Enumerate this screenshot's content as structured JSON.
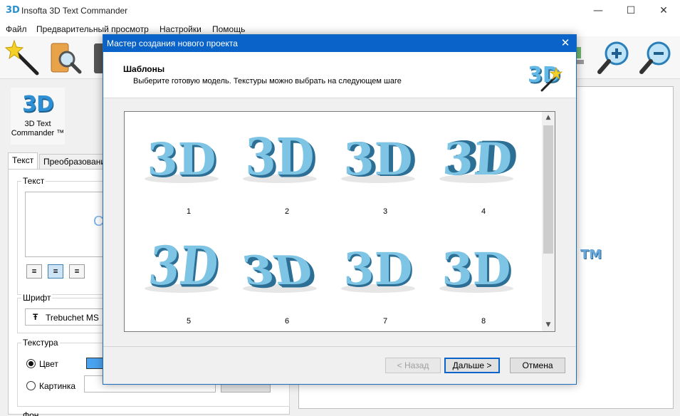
{
  "window": {
    "logo_text": "3D",
    "title": "Insofta 3D Text Commander",
    "minimize": "—",
    "maximize": "☐",
    "close": "✕"
  },
  "menu": [
    "Файл",
    "Предварительный просмотр",
    "Настройки",
    "Помощь"
  ],
  "toolbar": {
    "icons": [
      "magic-wand-icon",
      "open-folder-icon",
      "save-icon",
      "zoom-in-icon",
      "zoom-out-icon"
    ]
  },
  "left_panel": {
    "logo_text": "3D",
    "logo_caption": "3D Text Commander ™",
    "tabs": [
      "Текст",
      "Преобразование"
    ],
    "text_group": {
      "label": "Текст",
      "preview_glyph": "C"
    },
    "font_group": {
      "label": "Шрифт",
      "font_icon": "Ŧ",
      "font_name": "Trebuchet MS"
    },
    "texture_group": {
      "label": "Текстура",
      "color_label": "Цвет",
      "picture_label": "Картинка"
    },
    "background_label": "Фон"
  },
  "canvas": {
    "tm_text": "TM"
  },
  "dialog": {
    "title": "Мастер создания нового проекта",
    "close": "✕",
    "header_title": "Шаблоны",
    "header_subtitle": "Выберите готовую модель. Текстуры можно выбрать на следующем шаге",
    "header_icon_text": "3D",
    "templates": [
      {
        "label": "1",
        "text": "3D"
      },
      {
        "label": "2",
        "text": "3D"
      },
      {
        "label": "3",
        "text": "3D"
      },
      {
        "label": "4",
        "text": "3D"
      },
      {
        "label": "5",
        "text": "3D"
      },
      {
        "label": "6",
        "text": "3D"
      },
      {
        "label": "7",
        "text": "3D"
      },
      {
        "label": "8",
        "text": "3D"
      }
    ],
    "scroll_up": "▲",
    "scroll_down": "▼",
    "buttons": {
      "back": "< Назад",
      "next": "Дальше >",
      "cancel": "Отмена"
    }
  },
  "colors": {
    "accent": "#0a63c8",
    "text3d_face": "#7ec4e4",
    "text3d_side": "#2d6f95"
  }
}
